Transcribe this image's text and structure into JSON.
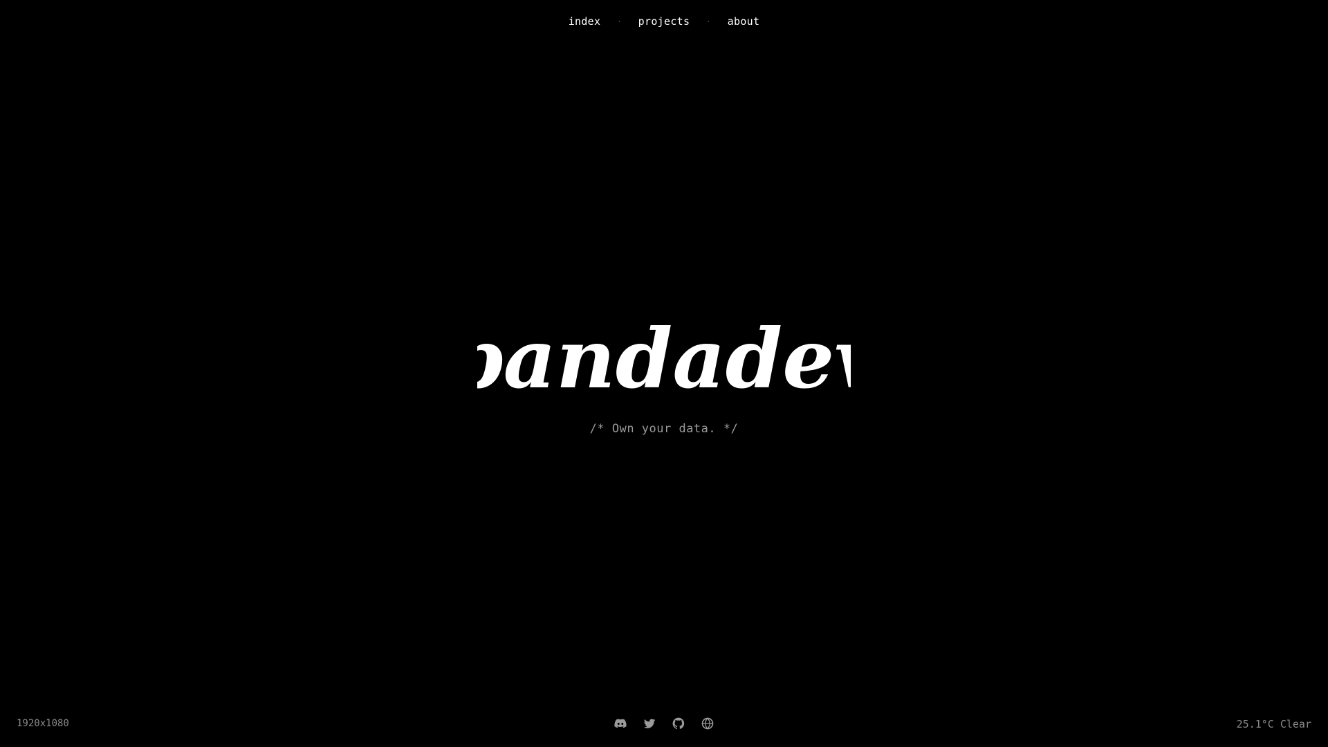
{
  "nav": {
    "items": [
      {
        "label": "index"
      },
      {
        "label": "projects"
      },
      {
        "label": "about"
      }
    ],
    "separator": "·"
  },
  "hero": {
    "logo_text": "pandadev",
    "tagline": "/* Own your data. */"
  },
  "footer": {
    "resolution": "1920x1080",
    "weather": "25.1°C Clear",
    "socials": [
      {
        "icon": "discord-icon"
      },
      {
        "icon": "twitter-icon"
      },
      {
        "icon": "github-icon"
      },
      {
        "icon": "globe-icon"
      }
    ]
  },
  "colors": {
    "background": "#000000",
    "text": "#ffffff",
    "muted": "#8a8a8a"
  }
}
